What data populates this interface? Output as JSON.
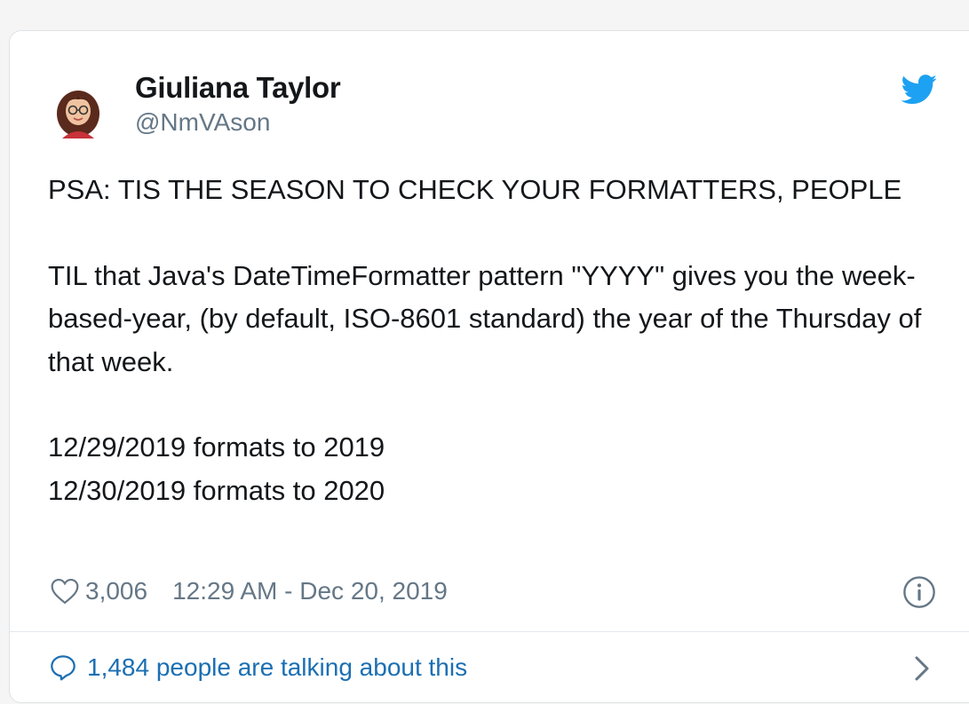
{
  "tweet": {
    "author": {
      "display_name": "Giuliana Taylor",
      "handle": "@NmVAson",
      "avatar_icon": "avatar-bitmoji"
    },
    "brand_icon": "twitter-bird-icon",
    "brand_color": "#1da1f2",
    "text_paragraphs": [
      "PSA: TIS THE SEASON TO CHECK YOUR FORMATTERS, PEOPLE",
      "TIL that Java's DateTimeFormatter pattern \"YYYY\" gives you the week-based-year, (by default, ISO-8601 standard) the year of the Thursday of that week.",
      "12/29/2019 formats to 2019\n12/30/2019 formats to 2020"
    ],
    "likes": "3,006",
    "timestamp": "12:29 AM - Dec 20, 2019",
    "conversation_label": "1,484 people are talking about this",
    "link_color": "#1b6fb3"
  }
}
